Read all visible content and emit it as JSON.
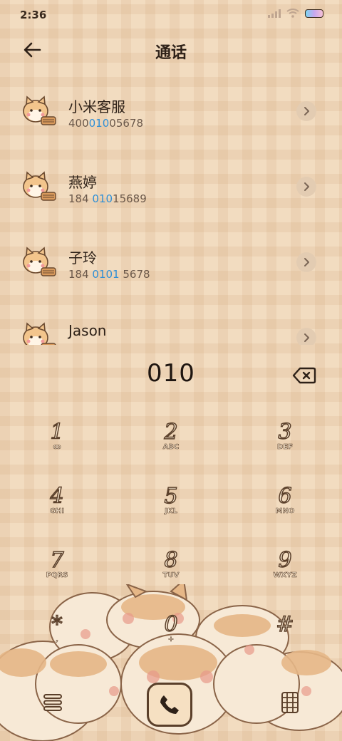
{
  "status": {
    "time": "2:36"
  },
  "header": {
    "title": "通话"
  },
  "contacts": [
    {
      "name": "小米客服",
      "number_pre": "400",
      "number_hl": "010",
      "number_post": "05678"
    },
    {
      "name": "燕婷",
      "number_pre": "184 ",
      "number_hl": "010",
      "number_post": "15689"
    },
    {
      "name": "子玲",
      "number_pre": "184 ",
      "number_hl": "0101",
      "number_post": " 5678"
    },
    {
      "name": "Jason",
      "number_pre": "",
      "number_hl": "",
      "number_post": ""
    }
  ],
  "dial": {
    "value": "010"
  },
  "keypad": [
    {
      "digit": "1",
      "letters": "ꝏ"
    },
    {
      "digit": "2",
      "letters": "ABC"
    },
    {
      "digit": "3",
      "letters": "DEF"
    },
    {
      "digit": "4",
      "letters": "GHI"
    },
    {
      "digit": "5",
      "letters": "JKL"
    },
    {
      "digit": "6",
      "letters": "MNO"
    },
    {
      "digit": "7",
      "letters": "PQRS"
    },
    {
      "digit": "8",
      "letters": "TUV"
    },
    {
      "digit": "9",
      "letters": "WXYZ"
    },
    {
      "digit": "*",
      "letters": ","
    },
    {
      "digit": "0",
      "letters": "+"
    },
    {
      "digit": "#",
      "letters": ""
    }
  ],
  "icons": {
    "back": "arrow-left-icon",
    "detail": "chevron-right-icon",
    "backspace": "backspace-icon",
    "menu": "menu-icon",
    "call": "phone-icon",
    "dialpad": "dialpad-icon"
  },
  "colors": {
    "highlight": "#2f8fd6",
    "accent": "#5a3f2a",
    "background": "#f2dcc0"
  }
}
